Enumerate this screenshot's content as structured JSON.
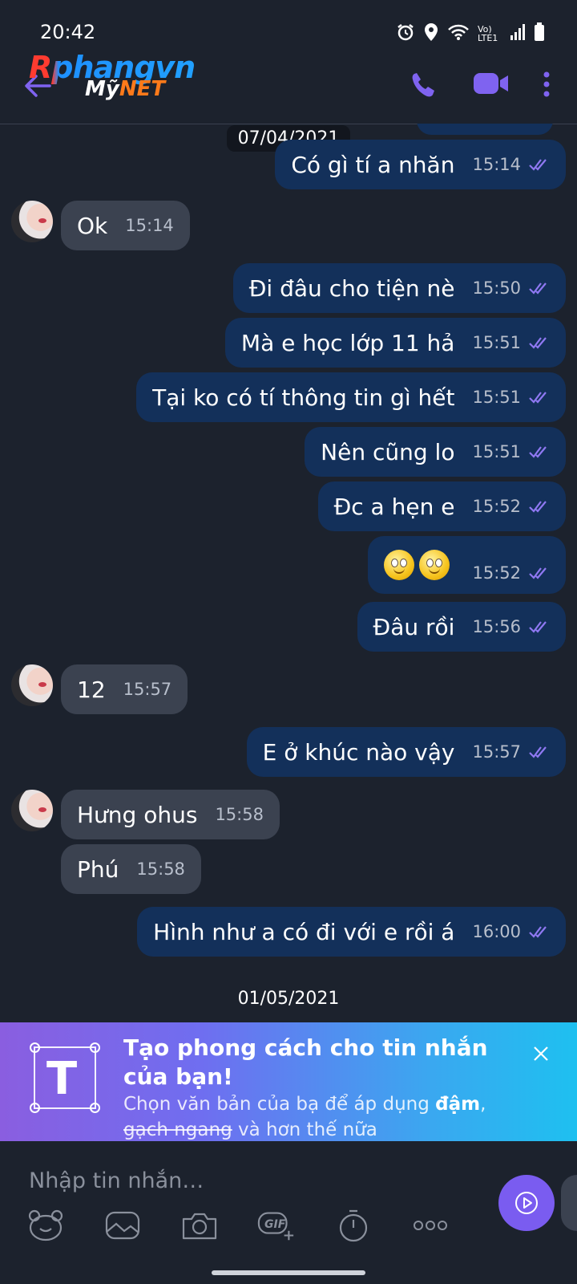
{
  "status_bar": {
    "time": "20:42",
    "network": "Vo) LTE1"
  },
  "header": {
    "logo_main": "Rphangvn",
    "logo_sub_my": "Mỹ",
    "logo_sub_net": "NET"
  },
  "chat": {
    "date_top": "07/04/2021",
    "messages": [
      {
        "text": "Có gì tí a nhăn",
        "time": "15:14"
      },
      {
        "text": "Ok",
        "time": "15:14"
      },
      {
        "text": "Đi đâu cho tiện nè",
        "time": "15:50"
      },
      {
        "text": "Mà e học lớp 11 hả",
        "time": "15:51"
      },
      {
        "text": "Tại ko có tí thông tin gì hết",
        "time": "15:51"
      },
      {
        "text": "Nên cũng lo",
        "time": "15:51"
      },
      {
        "text": "Đc a hẹn e",
        "time": "15:52"
      },
      {
        "text": "🙂🙂",
        "time": "15:52"
      },
      {
        "text": "Đâu rồi",
        "time": "15:56"
      },
      {
        "text": "12",
        "time": "15:57"
      },
      {
        "text": "E ở khúc nào vậy",
        "time": "15:57"
      },
      {
        "text": "Hưng ohus",
        "time": "15:58"
      },
      {
        "text": "Phú",
        "time": "15:58"
      },
      {
        "text": "Hình như a có đi với e rồi á",
        "time": "16:00"
      }
    ],
    "date_bottom": "01/05/2021"
  },
  "banner": {
    "icon_letter": "T",
    "title": "Tạo phong cách cho tin nhắn của bạn!",
    "desc_1": "Chọn văn bản của bạ để áp dụng ",
    "desc_bold": "đậm",
    "desc_2": ",",
    "desc_strike": "gạch ngang",
    "desc_3": " và hơn thế nữa"
  },
  "composer": {
    "placeholder": "Nhập tin nhắn…",
    "gif_label": "GIF"
  },
  "colors": {
    "background": "#1c222d",
    "outgoing_bubble": "#13305a",
    "incoming_bubble": "#3b4250",
    "accent": "#7a5cf0"
  }
}
